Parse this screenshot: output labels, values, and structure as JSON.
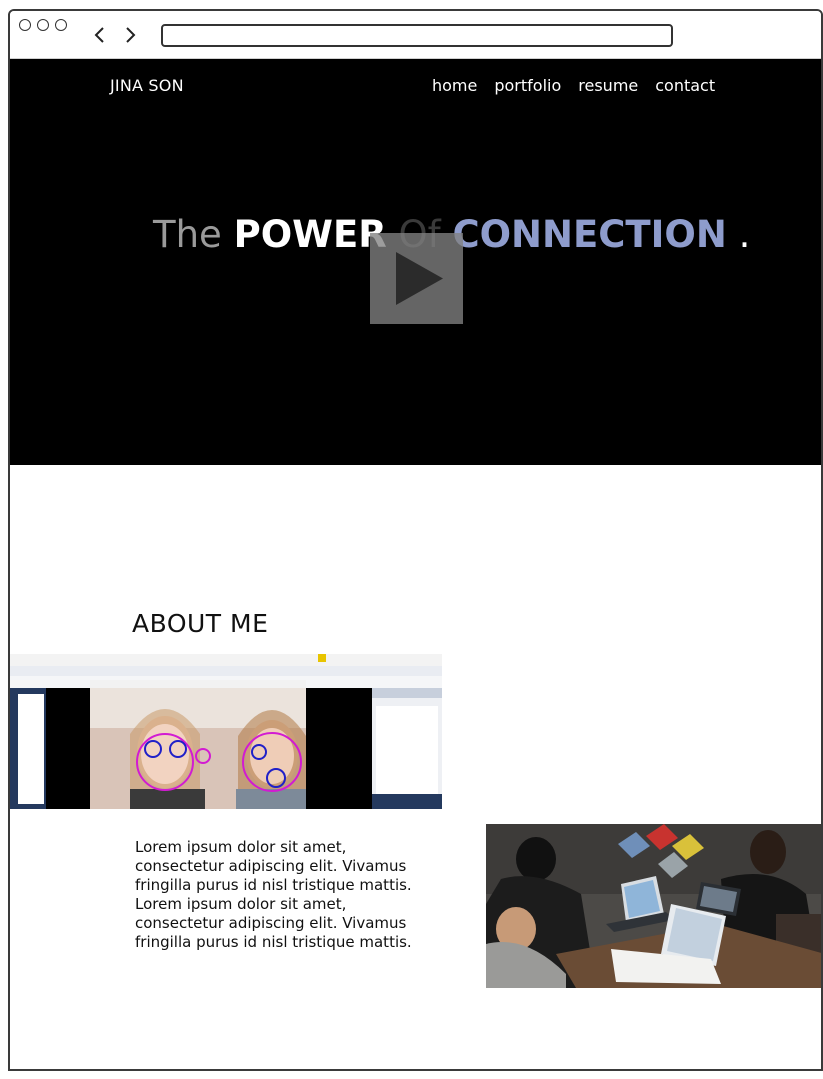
{
  "browser": {
    "back_icon": "chevron-left-icon",
    "forward_icon": "chevron-right-icon",
    "url": ""
  },
  "site": {
    "brand": "JINA SON",
    "nav": [
      {
        "label": "home"
      },
      {
        "label": "portfolio"
      },
      {
        "label": "resume"
      },
      {
        "label": "contact"
      }
    ]
  },
  "hero": {
    "headline": {
      "word1": "The",
      "word2": "POWER",
      "word3": "Of",
      "word4": "CONNECTION",
      "word5": "."
    },
    "play_icon": "play-icon",
    "colors": {
      "background": "#000000",
      "accent": "#8e9ccc"
    }
  },
  "about": {
    "title": "ABOUT ME",
    "body": "Lorem ipsum dolor sit amet, consectetur adipiscing elit. Vivamus fringilla purus id nisl tristique mattis. Lorem ipsum dolor sit amet, consectetur adipiscing elit. Vivamus fringilla purus id nisl tristique mattis."
  }
}
